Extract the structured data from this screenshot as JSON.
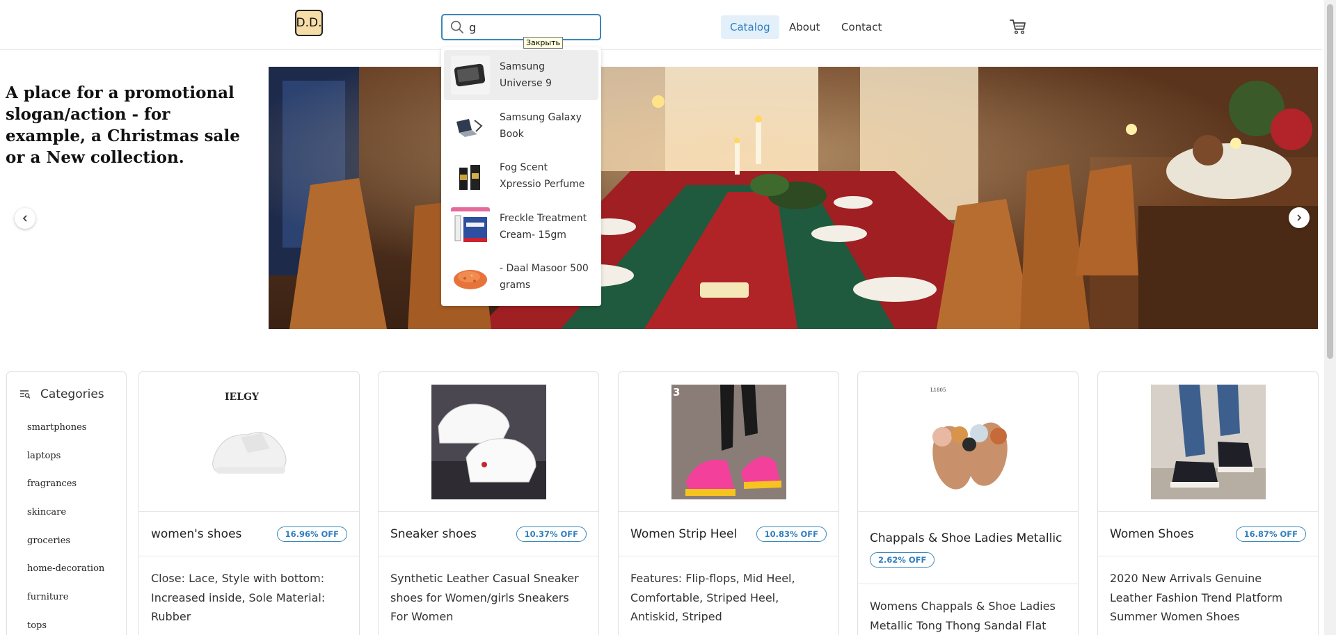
{
  "header": {
    "logo": "D.D.",
    "search": {
      "value": "g",
      "placeholder": ""
    },
    "tooltip": "Закрыть",
    "nav": [
      {
        "label": "Catalog",
        "active": true
      },
      {
        "label": "About",
        "active": false
      },
      {
        "label": "Contact",
        "active": false
      }
    ]
  },
  "suggestions": [
    {
      "name": "Samsung Universe 9",
      "icon": "phone-thumb"
    },
    {
      "name": "Samsung Galaxy Book",
      "icon": "laptop-thumb"
    },
    {
      "name": "Fog Scent Xpressio Perfume",
      "icon": "perfume-thumb"
    },
    {
      "name": "Freckle Treatment Cream- 15gm",
      "icon": "cream-thumb"
    },
    {
      "name": "- Daal Masoor 500 grams",
      "icon": "lentils-thumb"
    }
  ],
  "hero": {
    "slogan": "A place for a promotional slogan/action - for example, a Christmas sale or a New collection."
  },
  "categories": {
    "title": "Categories",
    "items": [
      "smartphones",
      "laptops",
      "fragrances",
      "skincare",
      "groceries",
      "home-decoration",
      "furniture",
      "tops"
    ]
  },
  "products": [
    {
      "name": "women's shoes",
      "discount": "16.96% OFF",
      "description": "Close: Lace, Style with bottom: Increased inside, Sole Material: Rubber",
      "image_text": "IELGY"
    },
    {
      "name": "Sneaker shoes",
      "discount": "10.37% OFF",
      "description": "Synthetic Leather Casual Sneaker shoes for Women/girls Sneakers For Women"
    },
    {
      "name": "Women Strip Heel",
      "discount": "10.83% OFF",
      "description": "Features: Flip-flops, Mid Heel, Comfortable, Striped Heel, Antiskid, Striped",
      "image_text": "3"
    },
    {
      "name": "Chappals & Shoe Ladies Metallic",
      "discount": "2.62% OFF",
      "description": "Womens Chappals & Shoe Ladies Metallic Tong Thong Sandal Flat",
      "image_text": "L1805"
    },
    {
      "name": "Women Shoes",
      "discount": "16.87% OFF",
      "description": "2020 New Arrivals Genuine Leather Fashion Trend Platform Summer Women Shoes"
    }
  ],
  "colors": {
    "accent": "#3a87b8",
    "nav_active_bg": "#e3f0fa",
    "logo_bg": "#f6dca8"
  }
}
